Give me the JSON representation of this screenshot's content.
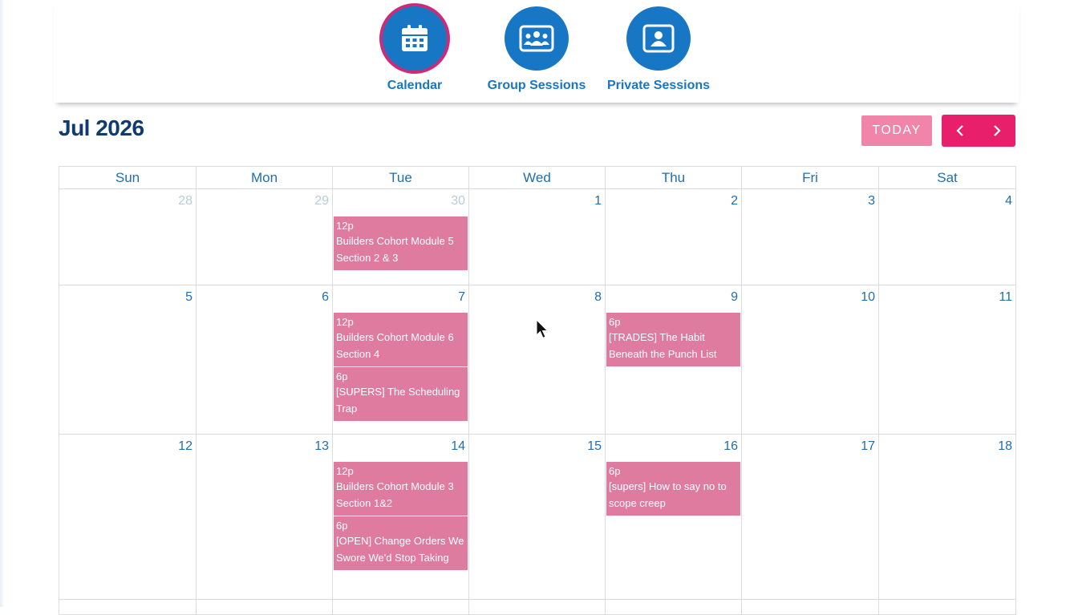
{
  "nav": {
    "items": [
      {
        "label": "Calendar",
        "icon": "calendar-icon",
        "active": true
      },
      {
        "label": "Group Sessions",
        "icon": "group-icon",
        "active": false
      },
      {
        "label": "Private Sessions",
        "icon": "contact-card-icon",
        "active": false
      }
    ]
  },
  "header": {
    "month": "Jul 2026",
    "today_label": "TODAY",
    "prev_icon": "chevron-left-icon",
    "next_icon": "chevron-right-icon"
  },
  "calendar": {
    "weekdays": [
      "Sun",
      "Mon",
      "Tue",
      "Wed",
      "Thu",
      "Fri",
      "Sat"
    ],
    "weeks": [
      {
        "days": [
          {
            "num": "28",
            "muted": true
          },
          {
            "num": "29",
            "muted": true
          },
          {
            "num": "30",
            "muted": true,
            "events": [
              {
                "time": "12p",
                "title": "Builders Cohort Module 5 Section 2 & 3"
              }
            ]
          },
          {
            "num": "1"
          },
          {
            "num": "2"
          },
          {
            "num": "3"
          },
          {
            "num": "4"
          }
        ]
      },
      {
        "days": [
          {
            "num": "5"
          },
          {
            "num": "6"
          },
          {
            "num": "7",
            "events": [
              {
                "time": "12p",
                "title": "Builders Cohort Module 6 Section 4"
              },
              {
                "time": "6p",
                "title": "[SUPERS] The Scheduling Trap"
              }
            ]
          },
          {
            "num": "8"
          },
          {
            "num": "9",
            "events": [
              {
                "time": "6p",
                "title": "[TRADES] The Habit Beneath the Punch List"
              }
            ]
          },
          {
            "num": "10"
          },
          {
            "num": "11"
          }
        ]
      },
      {
        "days": [
          {
            "num": "12"
          },
          {
            "num": "13"
          },
          {
            "num": "14",
            "events": [
              {
                "time": "12p",
                "title": "Builders Cohort Module 3 Section 1&2"
              },
              {
                "time": "6p",
                "title": "[OPEN] Change Orders We Swore We'd Stop Taking"
              }
            ]
          },
          {
            "num": "15"
          },
          {
            "num": "16",
            "events": [
              {
                "time": "6p",
                "title": "[supers] How to say no to scope creep"
              }
            ]
          },
          {
            "num": "17"
          },
          {
            "num": "18"
          }
        ]
      },
      {
        "days": [
          {
            "num": ""
          },
          {
            "num": ""
          },
          {
            "num": ""
          },
          {
            "num": ""
          },
          {
            "num": ""
          },
          {
            "num": ""
          },
          {
            "num": ""
          }
        ]
      }
    ]
  },
  "colors": {
    "brand_blue": "#1877c4",
    "title_navy": "#0f3b6e",
    "accent_pink": "#e8206b",
    "today_pink": "#f184a9",
    "event_pink": "#e07ba0",
    "active_ring": "#cf2a78"
  }
}
